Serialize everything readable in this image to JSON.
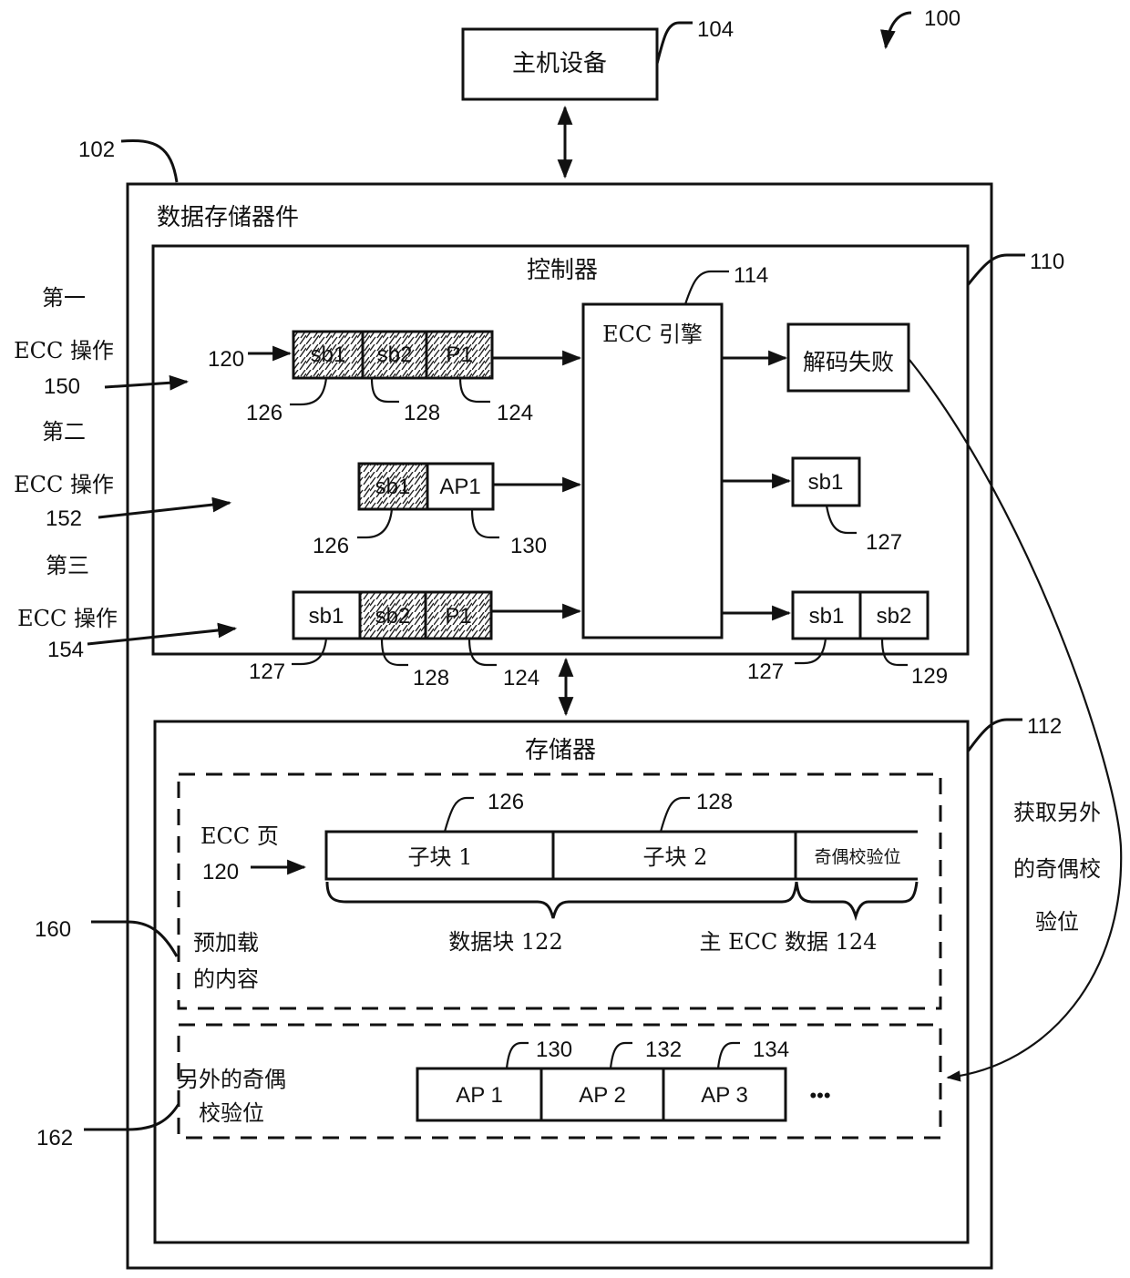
{
  "figure_ref": "100",
  "host": {
    "label": "主机设备",
    "ref": "104"
  },
  "device": {
    "label": "数据存储器件",
    "ref": "102"
  },
  "controller": {
    "label": "控制器",
    "ref": "110"
  },
  "ecc_engine": {
    "label": "ECC 引擎",
    "ref": "114"
  },
  "operations": [
    {
      "line1": "第一",
      "line2": "ECC 操作",
      "ref": "150"
    },
    {
      "line1": "第二",
      "line2": "ECC 操作",
      "ref": "152"
    },
    {
      "line1": "第三",
      "line2": "ECC 操作",
      "ref": "154"
    }
  ],
  "op1": {
    "input_ref": "120",
    "cells": [
      {
        "label": "sb1",
        "hatched": true,
        "ref": "126"
      },
      {
        "label": "sb2",
        "hatched": true,
        "ref": "128"
      },
      {
        "label": "P1",
        "hatched": true,
        "ref": "124"
      }
    ],
    "output": {
      "label": "解码失败"
    }
  },
  "op2": {
    "cells": [
      {
        "label": "sb1",
        "hatched": true,
        "ref": "126"
      },
      {
        "label": "AP1",
        "hatched": false,
        "ref": "130"
      }
    ],
    "output": {
      "label": "sb1",
      "ref": "127"
    }
  },
  "op3": {
    "cells": [
      {
        "label": "sb1",
        "hatched": false,
        "ref": "127"
      },
      {
        "label": "sb2",
        "hatched": true,
        "ref": "128"
      },
      {
        "label": "P1",
        "hatched": true,
        "ref": "124"
      }
    ],
    "output": [
      {
        "label": "sb1",
        "ref": "127"
      },
      {
        "label": "sb2",
        "ref": "129"
      }
    ]
  },
  "memory": {
    "label": "存储器",
    "ref": "112",
    "preloaded": {
      "label_line1": "预加载",
      "label_line2": "的内容",
      "ref": "160",
      "ecc_page_label": "ECC 页",
      "ecc_page_ref": "120",
      "cells": [
        {
          "label": "子块 1",
          "ref": "126"
        },
        {
          "label": "子块 2",
          "ref": "128"
        },
        {
          "label": "奇偶校验位"
        }
      ],
      "brace_data": "数据块 122",
      "brace_ecc": "主 ECC 数据 124"
    },
    "additional": {
      "label_line1": "另外的奇偶",
      "label_line2": "校验位",
      "ref": "162",
      "cells": [
        {
          "label": "AP 1",
          "ref": "130"
        },
        {
          "label": "AP 2",
          "ref": "132"
        },
        {
          "label": "AP 3",
          "ref": "134"
        }
      ],
      "ellipsis": "•••"
    }
  },
  "fetch_note": {
    "line1": "获取另外",
    "line2": "的奇偶校",
    "line3": "验位"
  }
}
